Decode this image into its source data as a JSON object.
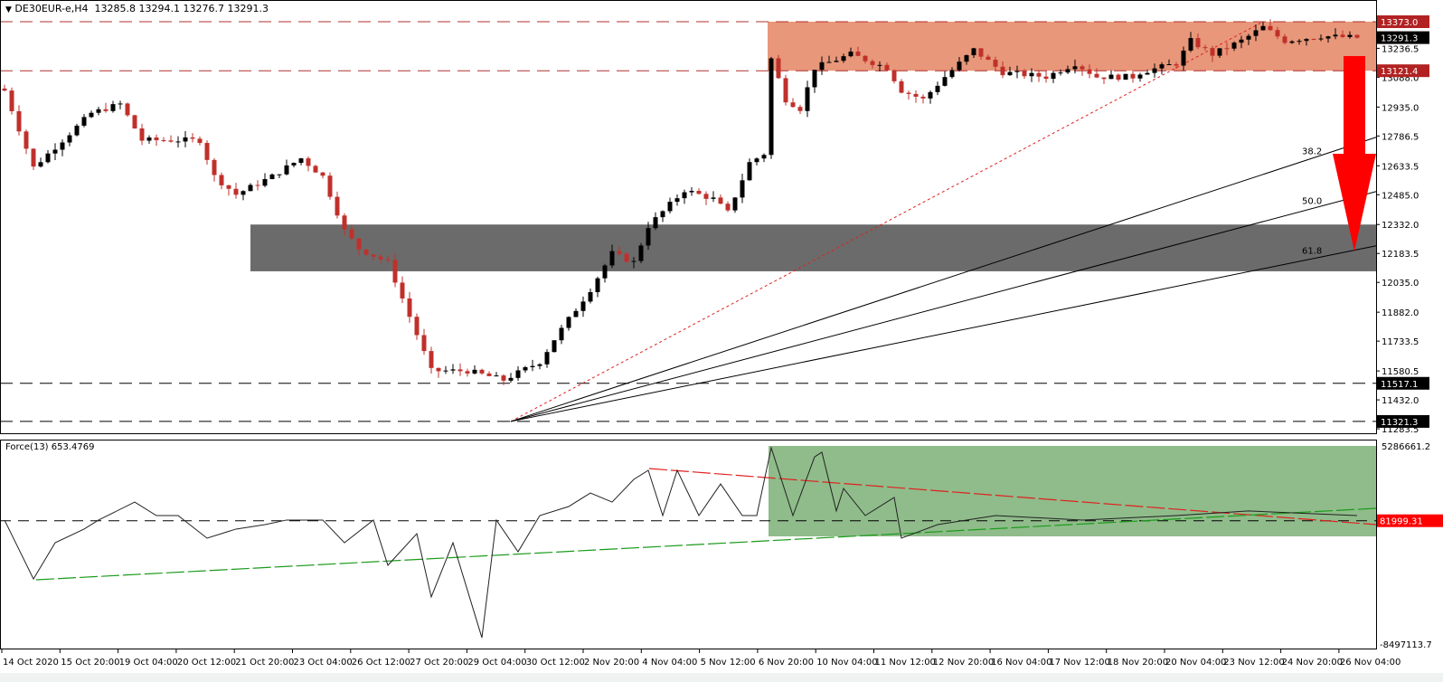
{
  "header": {
    "symbol": "DE30EUR-e,H4",
    "open": "13285.8",
    "high": "13294.1",
    "low": "13276.7",
    "close": "13291.3"
  },
  "indicator": {
    "label": "Force(13) 653.4769"
  },
  "colors": {
    "bull": "#000000",
    "bear": "#c0302b",
    "resistance_zone": "#e8977a",
    "support_zone": "#6b6b6b",
    "force_zone": "#8fbc8a",
    "arrow": "#ff0000"
  },
  "chart_data": [
    {
      "type": "candlestick",
      "title": "DE30EUR-e,H4",
      "ylim": [
        11283.5,
        13400
      ],
      "price_ticks": [
        "13236.5",
        "13088.0",
        "12935.0",
        "12786.5",
        "12633.5",
        "12485.0",
        "12332.0",
        "12183.5",
        "12035.0",
        "11882.0",
        "11733.5",
        "11580.5",
        "11432.0",
        "11283.5"
      ],
      "time_ticks": [
        "14 Oct 2020",
        "15 Oct 20:00",
        "19 Oct 04:00",
        "20 Oct 12:00",
        "21 Oct 20:00",
        "23 Oct 04:00",
        "26 Oct 12:00",
        "27 Oct 20:00",
        "29 Oct 04:00",
        "30 Oct 12:00",
        "2 Nov 20:00",
        "4 Nov 04:00",
        "5 Nov 12:00",
        "6 Nov 20:00",
        "10 Nov 04:00",
        "11 Nov 12:00",
        "12 Nov 20:00",
        "16 Nov 04:00",
        "17 Nov 12:00",
        "18 Nov 20:00",
        "20 Nov 04:00",
        "23 Nov 12:00",
        "24 Nov 20:00",
        "26 Nov 04:00"
      ],
      "bars_count": 188,
      "close_path": [
        [
          0,
          13020
        ],
        [
          4,
          12625
        ],
        [
          12,
          12904
        ],
        [
          16,
          12950
        ],
        [
          19,
          12765
        ],
        [
          27,
          12765
        ],
        [
          29,
          12579
        ],
        [
          32,
          12486
        ],
        [
          37,
          12579
        ],
        [
          41,
          12672
        ],
        [
          44,
          12579
        ],
        [
          47,
          12300
        ],
        [
          49,
          12208
        ],
        [
          53,
          12138
        ],
        [
          57,
          11767
        ],
        [
          59,
          11581
        ],
        [
          64,
          11581
        ],
        [
          69,
          11534
        ],
        [
          74,
          11627
        ],
        [
          76,
          11743
        ],
        [
          81,
          11999
        ],
        [
          84,
          12184
        ],
        [
          87,
          12138
        ],
        [
          89,
          12324
        ],
        [
          94,
          12509
        ],
        [
          98,
          12463
        ],
        [
          100,
          12393
        ],
        [
          103,
          12649
        ],
        [
          105,
          12695
        ],
        [
          106,
          13183
        ],
        [
          108,
          12974
        ],
        [
          110,
          12927
        ],
        [
          112,
          13136
        ],
        [
          117,
          13206
        ],
        [
          122,
          13136
        ],
        [
          124,
          13020
        ],
        [
          127,
          12974
        ],
        [
          130,
          13090
        ],
        [
          134,
          13229
        ],
        [
          138,
          13113
        ],
        [
          144,
          13090
        ],
        [
          148,
          13159
        ],
        [
          151,
          13090
        ],
        [
          156,
          13090
        ],
        [
          157,
          13113
        ],
        [
          162,
          13159
        ],
        [
          164,
          13275
        ],
        [
          167,
          13206
        ],
        [
          171,
          13275
        ],
        [
          174,
          13345
        ],
        [
          177,
          13275
        ],
        [
          182,
          13299
        ],
        [
          187,
          13291.3
        ]
      ],
      "levels": [
        {
          "label": "13373.0",
          "price": 13373.0,
          "style": "red-dashed",
          "badge": "red"
        },
        {
          "label": "13121.4",
          "price": 13121.4,
          "style": "red-dashed",
          "badge": "red"
        },
        {
          "label": "11517.1",
          "price": 11517.1,
          "style": "black-dashed",
          "badge": "black"
        },
        {
          "label": "11321.3",
          "price": 11321.3,
          "style": "black-dashed",
          "badge": "black"
        }
      ],
      "current_price": "13291.3",
      "zones": {
        "resistance": [
          13121.4,
          13373.0
        ],
        "support": [
          12092,
          12332
        ]
      },
      "fib_fan": {
        "from": [
          70,
          11321.3
        ],
        "to": [
          174,
          13373.0
        ],
        "levels": [
          "38.2",
          "50.0",
          "61.8"
        ]
      }
    },
    {
      "type": "line",
      "title": "Force(13) 653.4769",
      "ylim": [
        -8497113.7,
        5286661.2
      ],
      "y_ticks": [
        "5286661.2",
        "-8497113.7"
      ],
      "current_value": "81999.31",
      "values_millions": [
        [
          0,
          0.13
        ],
        [
          4,
          -3.97
        ],
        [
          7,
          -1.45
        ],
        [
          11,
          -0.5
        ],
        [
          13,
          0.13
        ],
        [
          18,
          1.38
        ],
        [
          21,
          0.44
        ],
        [
          24,
          0.44
        ],
        [
          28,
          -1.13
        ],
        [
          32,
          -0.5
        ],
        [
          36,
          -0.19
        ],
        [
          39,
          0.13
        ],
        [
          44,
          0.13
        ],
        [
          47,
          -1.45
        ],
        [
          51,
          0.13
        ],
        [
          53,
          -3.02
        ],
        [
          57,
          -0.82
        ],
        [
          59,
          -5.22
        ],
        [
          62,
          -1.45
        ],
        [
          66,
          -8.06
        ],
        [
          68,
          0.13
        ],
        [
          71,
          -2.08
        ],
        [
          74,
          0.44
        ],
        [
          78,
          1.07
        ],
        [
          81,
          2.01
        ],
        [
          84,
          1.38
        ],
        [
          87,
          2.96
        ],
        [
          89,
          3.59
        ],
        [
          91,
          0.44
        ],
        [
          93,
          3.59
        ],
        [
          96,
          0.44
        ],
        [
          99,
          2.64
        ],
        [
          102,
          0.44
        ],
        [
          104,
          0.44
        ],
        [
          106,
          5.16
        ],
        [
          109,
          0.44
        ],
        [
          112,
          4.53
        ],
        [
          113,
          4.85
        ],
        [
          115,
          0.76
        ],
        [
          116,
          2.33
        ],
        [
          119,
          0.44
        ],
        [
          123,
          1.7
        ],
        [
          124,
          -1.13
        ],
        [
          129,
          -0.19
        ],
        [
          137,
          0.44
        ],
        [
          149,
          0.13
        ],
        [
          162,
          0.44
        ],
        [
          172,
          0.76
        ],
        [
          187,
          0.44
        ]
      ]
    }
  ]
}
